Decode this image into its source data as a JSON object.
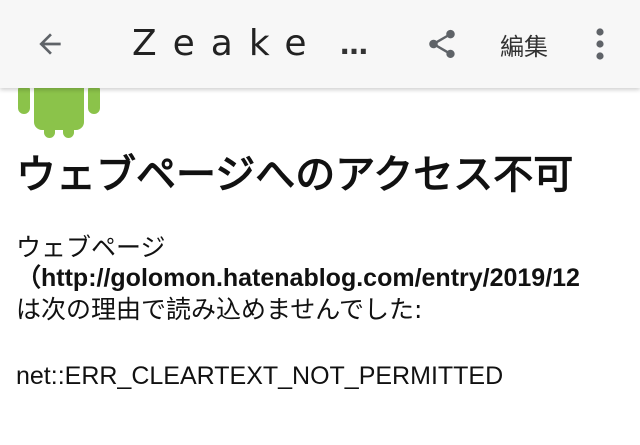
{
  "toolbar": {
    "back_icon": "arrow-back-icon",
    "title": "Zeake",
    "ellipsis": "…",
    "share_icon": "share-icon",
    "edit_label": "編集",
    "more_icon": "more-vert-icon"
  },
  "page": {
    "android_icon": "android-robot-icon",
    "heading": "ウェブページへのアクセス不可",
    "line1": "ウェブページ",
    "url_line": "（http://golomon.hatenablog.com/entry/2019/12",
    "line3": "は次の理由で読み込めませんでした:",
    "error_code": "net::ERR_CLEARTEXT_NOT_PERMITTED"
  },
  "colors": {
    "toolbar_bg": "#f7f7f7",
    "android_green": "#8bc34a",
    "icon_gray": "#5f6368",
    "text": "#111111"
  }
}
